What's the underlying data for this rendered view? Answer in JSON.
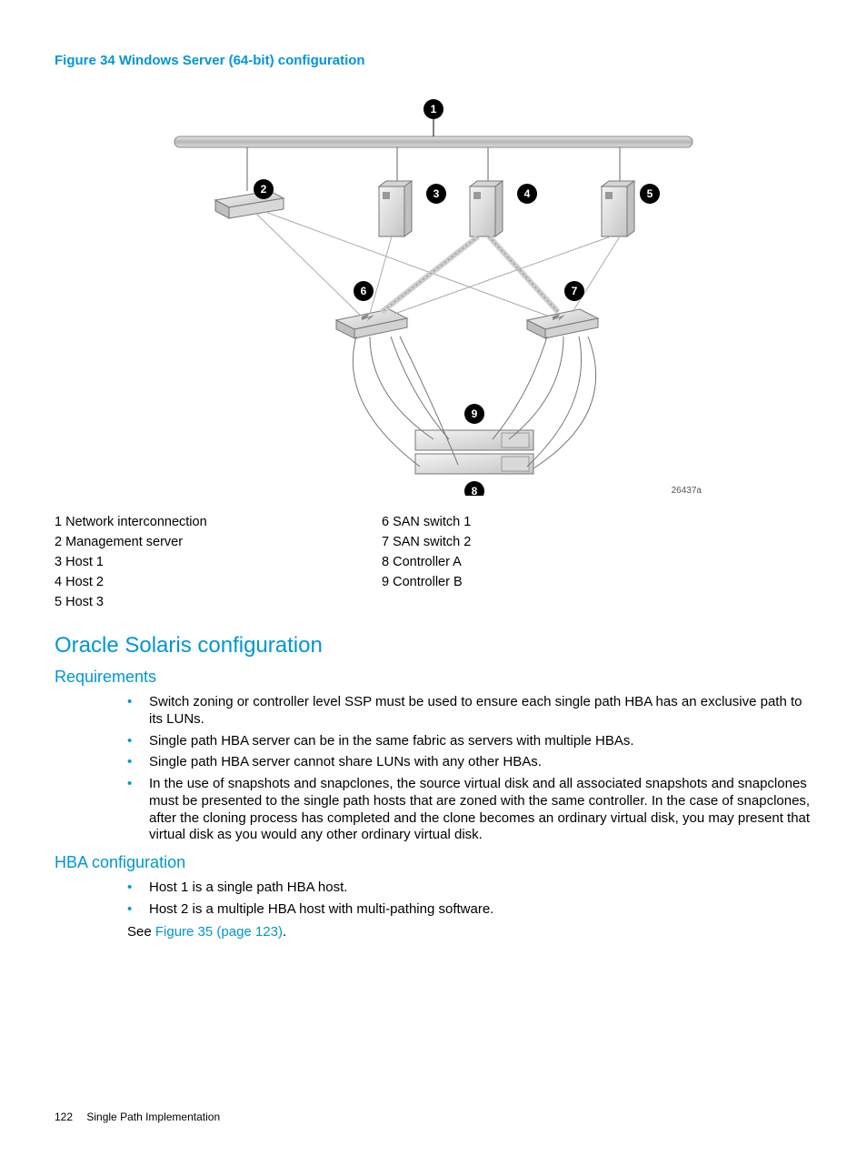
{
  "figure": {
    "caption": "Figure 34 Windows Server (64-bit) configuration",
    "ref": "26437a"
  },
  "legend": {
    "left": [
      "1 Network interconnection",
      "2 Management server",
      "3 Host 1",
      "4 Host 2",
      "5 Host 3"
    ],
    "right": [
      "6 SAN switch 1",
      "7 SAN switch 2",
      "8 Controller A",
      "9 Controller B"
    ]
  },
  "section": {
    "title": "Oracle Solaris configuration"
  },
  "requirements": {
    "heading": "Requirements",
    "items": [
      "Switch zoning or controller level SSP must be used to ensure each single path HBA has an exclusive path to its LUNs.",
      "Single path HBA server can be in the same fabric as servers with multiple HBAs.",
      "Single path HBA server cannot share LUNs with any other HBAs.",
      "In the use of snapshots and snapclones, the source virtual disk and all associated snapshots and snapclones must be presented to the single path hosts that are zoned with the same controller. In the case of snapclones, after the cloning process has completed and the clone becomes an ordinary virtual disk, you may present that virtual disk as you would any other ordinary virtual disk."
    ]
  },
  "hba": {
    "heading": "HBA configuration",
    "items": [
      "Host 1 is a single path HBA host.",
      "Host 2 is a multiple HBA host with multi-pathing software."
    ],
    "see_prefix": "See ",
    "see_link": "Figure 35 (page 123)",
    "see_suffix": "."
  },
  "footer": {
    "page": "122",
    "title": "Single Path Implementation"
  },
  "callouts": [
    "1",
    "2",
    "3",
    "4",
    "5",
    "6",
    "7",
    "8",
    "9"
  ]
}
